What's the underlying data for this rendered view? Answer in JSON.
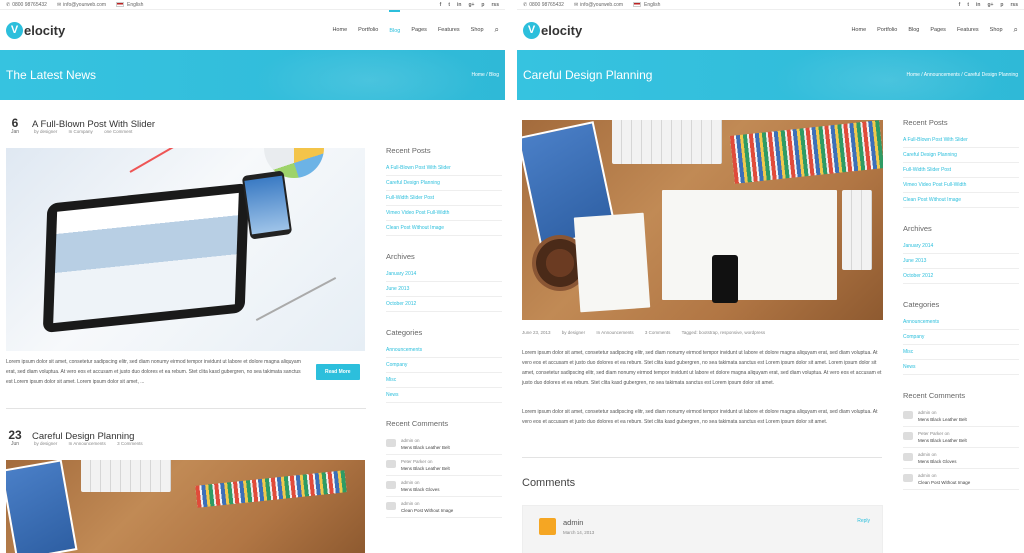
{
  "topbar": {
    "phone": "0800 98765432",
    "email": "info@yourweb.com",
    "language": "English",
    "social": [
      "f",
      "t",
      "in",
      "g+",
      "p",
      "rss"
    ]
  },
  "brand": {
    "logo_letter": "V",
    "logo_rest": "elocity"
  },
  "nav": [
    "Home",
    "Portfolio",
    "Blog",
    "Pages",
    "Features",
    "Shop"
  ],
  "left": {
    "banner_title": "The Latest News",
    "breadcrumb": "Home  /  Blog",
    "posts": [
      {
        "day": "6",
        "month": "Jan",
        "title": "A Full-Blown Post With Slider",
        "meta": [
          "by designer",
          "In Company",
          "one Comment"
        ],
        "excerpt": "Lorem ipsum dolor sit amet, consetetur sadipscing elitr, sed diam nonumy eirmod tempor invidunt ut labore et dolore magna aliquyam erat, sed diam voluptua. At vero eos et accusam et justo duo dolores et ea rebum. Stet clita kasd gubergren, no sea takimata sanctus est Lorem ipsum dolor sit amet. Lorem ipsum dolor sit amet, ...",
        "read_more": "Read More"
      },
      {
        "day": "23",
        "month": "Jun",
        "title": "Careful Design Planning",
        "meta": [
          "by designer",
          "In Announcements",
          "3 Comments"
        ]
      }
    ]
  },
  "right": {
    "banner_title": "Careful Design Planning",
    "breadcrumb": "Home  /  Announcements  /  Careful Design Planning",
    "meta": [
      "June 23, 2013",
      "by designer",
      "In Announcements",
      "3 Comments",
      "Tagged: bootstrap, responsive, wordpress"
    ],
    "para1": "Lorem ipsum dolor sit amet, consetetur sadipscing elitr, sed diam nonumy eirmod tempor invidunt ut labore et dolore magna aliquyam erat, sed diam voluptua. At vero eos et accusam et justo duo dolores et ea rebum. Stet clita kasd gubergren, no sea takimata sanctus est Lorem ipsum dolor sit amet. Lorem ipsum dolor sit amet, consetetur sadipscing elitr, sed diam nonumy eirmod tempor invidunt ut labore et dolore magna aliquyam erat, sed diam voluptua. At vero eos et accusam et justo duo dolores et ea rebum. Stet clita kasd gubergren, no sea takimata sanctus est Lorem ipsum dolor sit amet.",
    "para2": "Lorem ipsum dolor sit amet, consetetur sadipscing elitr, sed diam nonumy eirmod tempor invidunt ut labore et dolore magna aliquyam erat, sed diam voluptua. At vero eos et accusam et justo duo dolores et ea rebum. Stet clita kasd gubergren, no sea takimata sanctus est Lorem ipsum dolor sit amet.",
    "comments_title": "Comments",
    "comment": {
      "author": "admin",
      "date": "March 14, 2013",
      "reply": "Reply"
    }
  },
  "sidebar": {
    "recent_posts_title": "Recent Posts",
    "recent_posts": [
      "A Full-Blown Post With Slider",
      "Careful Design Planning",
      "Full-Width Slider Post",
      "Vimeo Video Post Full-Width",
      "Clean Post Without Image"
    ],
    "archives_title": "Archives",
    "archives": [
      "January 2014",
      "June 2013",
      "October 2012"
    ],
    "categories_title": "Categories",
    "categories": [
      "Announcements",
      "Company",
      "Misc",
      "News"
    ],
    "recent_comments_title": "Recent Comments",
    "recent_comments_left": [
      {
        "who": "admin on",
        "what": "Mens Black Leather Belt"
      },
      {
        "who": "Peter Parker on",
        "what": "Mens Black Leather Belt"
      },
      {
        "who": "admin on",
        "what": "Mens Black Gloves"
      },
      {
        "who": "admin on",
        "what": "Clean Post Without Image"
      }
    ],
    "recent_comments_right": [
      {
        "who": "admin on",
        "what": "Mens Black Leather Belt"
      },
      {
        "who": "Peter Parker on",
        "what": "Mens Black Leather Belt"
      },
      {
        "who": "admin on",
        "what": "Mens Black Gloves"
      },
      {
        "who": "admin on",
        "what": "Clean Post Without Image"
      }
    ]
  },
  "colors": {
    "accent": "#2cbfdc"
  }
}
